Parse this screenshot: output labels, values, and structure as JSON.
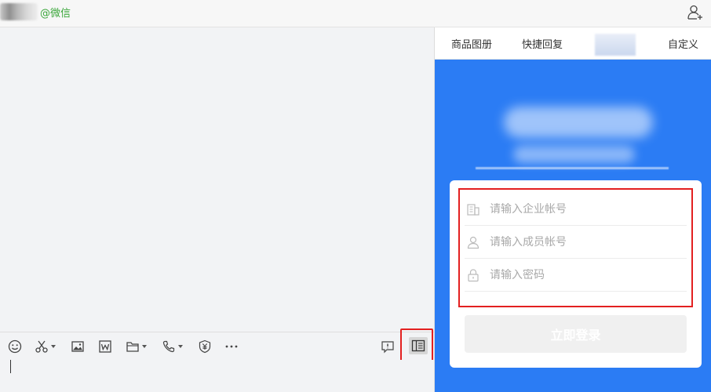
{
  "header": {
    "contact_name": "@微信",
    "add_member_icon": "add-user-icon"
  },
  "toolbar": {
    "icons": [
      "emoji-icon",
      "scissors-icon",
      "image-icon",
      "word-doc-icon",
      "folder-icon",
      "phone-icon",
      "yuan-shield-icon",
      "more-icon",
      "message-alert-icon",
      "side-panel-icon"
    ]
  },
  "side_panel": {
    "tabs": [
      "商品图册",
      "快捷回复",
      "",
      "自定义"
    ],
    "login": {
      "enterprise_placeholder": "请输入企业帐号",
      "member_placeholder": "请输入成员帐号",
      "password_placeholder": "请输入密码",
      "login_button": "立即登录"
    }
  },
  "colors": {
    "brand_blue": "#2b7cf4",
    "highlight_red": "#e32020",
    "wechat_green": "#3aa63a"
  }
}
